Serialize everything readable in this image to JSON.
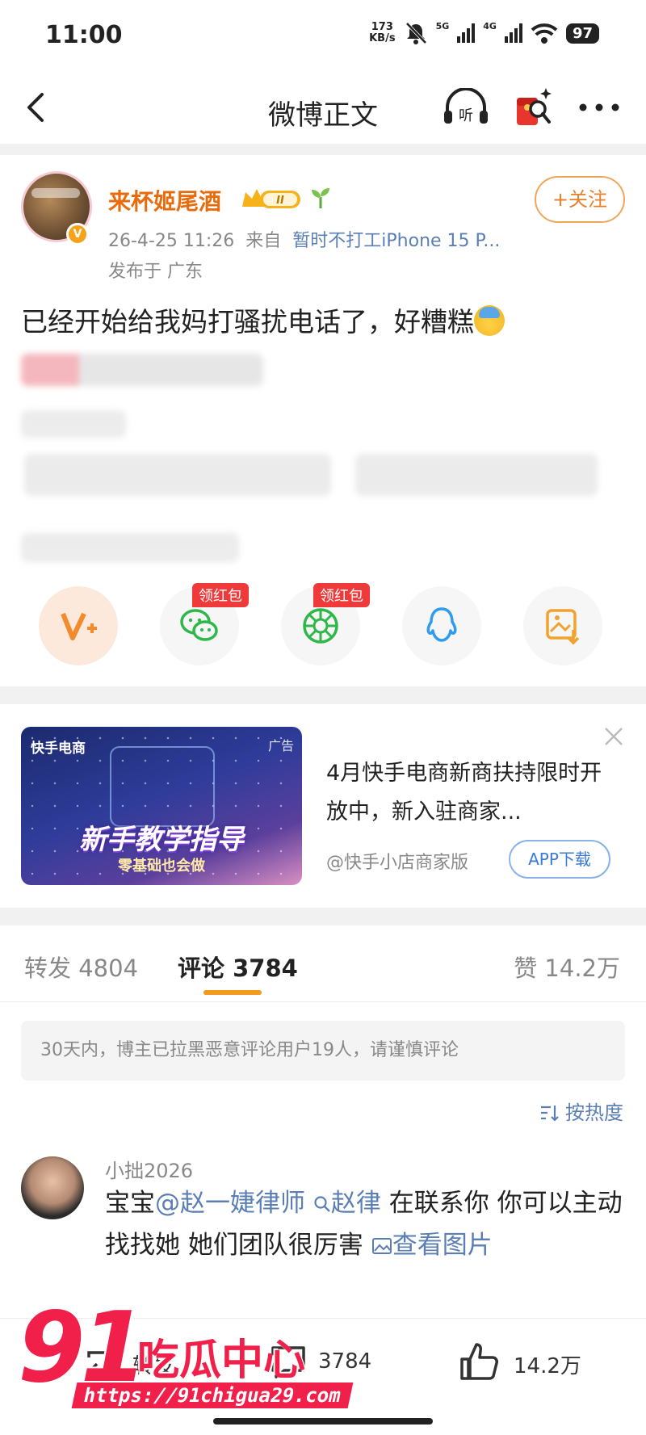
{
  "status_bar": {
    "time": "11:00",
    "net_speed_value": "173",
    "net_speed_unit": "KB/s",
    "net_5g": "5G",
    "net_4g": "4G",
    "battery": "97"
  },
  "nav": {
    "title": "微博正文",
    "listen_icon": "headphone-listen-icon",
    "listen_label": "听"
  },
  "post": {
    "username": "来杯姬尾酒",
    "member_level": "II",
    "timestamp": "26-4-25 11:26",
    "from_label": "来自",
    "source": "暂时不打工iPhone 15 P...",
    "location": "发布于 广东",
    "follow_label": "+关注",
    "text": "已经开始给我妈打骚扰电话了，好糟糕"
  },
  "share": {
    "wechat_tag": "领红包",
    "moments_tag": "领红包"
  },
  "ad": {
    "brand": "快手电商",
    "ad_label": "广告",
    "headline": "新手教学指导",
    "subline": "零基础也会做",
    "title": "4月快手电商新商扶持限时开放中，新入驻商家...",
    "source": "@快手小店商家版",
    "button": "APP下载"
  },
  "tabs": {
    "repost": "转发 4804",
    "comments": "评论 3784",
    "likes": "赞 14.2万"
  },
  "notice": "30天内，博主已拉黑恶意评论用户19人，请谨慎评论",
  "sort_label": "按热度",
  "comment": {
    "name": "小拙2026",
    "text_a": "宝宝",
    "mention": "@赵一婕律师",
    "search_link": "赵律",
    "text_b": " 在联系你 你可以主动找找她 她们团队很厉害 ",
    "view_image": "查看图片"
  },
  "bottom_bar": {
    "repost_label": "转发",
    "comment_count": "3784",
    "like_count": "14.2万"
  },
  "watermark": {
    "number": "91",
    "text": "吃瓜中心",
    "url": "https://91chigua29.com"
  },
  "colors": {
    "accent_orange": "#e86b0c",
    "link_blue": "#5b7fb5",
    "tab_underline": "#f39a1b",
    "red_tag": "#f03a3a",
    "watermark_red": "#f0204a"
  }
}
